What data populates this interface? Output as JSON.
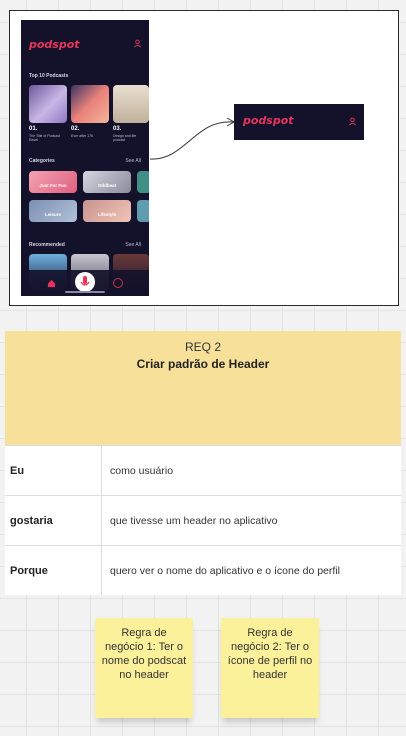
{
  "app_mockup": {
    "logo": "podspot",
    "profile_icon": "user-icon",
    "top_podcasts_label": "Top 10 Podcasts",
    "podcasts": [
      {
        "rank": "01.",
        "subtitle": "The Title of Podcast Ravel"
      },
      {
        "rank": "02.",
        "subtitle": "Ever after 176"
      },
      {
        "rank": "03.",
        "subtitle": "Design and life podcast"
      }
    ],
    "categories_label": "Categories",
    "see_all_1": "See All",
    "categories": [
      "Just For Fun",
      "Oddbeat",
      "Leisure",
      "Lifestyle"
    ],
    "recommended_label": "Recommended",
    "see_all_2": "See All",
    "nav_icons": [
      "home-icon",
      "mic-icon",
      "circle-icon"
    ]
  },
  "header_mockup": {
    "logo": "podspot",
    "profile_icon": "user-icon"
  },
  "requirement": {
    "id": "REQ 2",
    "title": "Criar padrão de Header",
    "rows": [
      {
        "key": "Eu",
        "value": "como usuário"
      },
      {
        "key": "gostaria",
        "value": "que tivesse um header no aplicativo"
      },
      {
        "key": "Porque",
        "value": "quero ver o nome do aplicativo e o ícone do perfil"
      }
    ]
  },
  "stickies": [
    {
      "text": "Regra de negócio 1: Ter o nome do podscat no header"
    },
    {
      "text": "Regra de negócio 2: Ter o ícone de perfil no header"
    }
  ],
  "colors": {
    "app_bg": "#14122a",
    "brand": "#e8345c",
    "req_header": "#f7e19a",
    "sticky": "#fbf19a"
  }
}
